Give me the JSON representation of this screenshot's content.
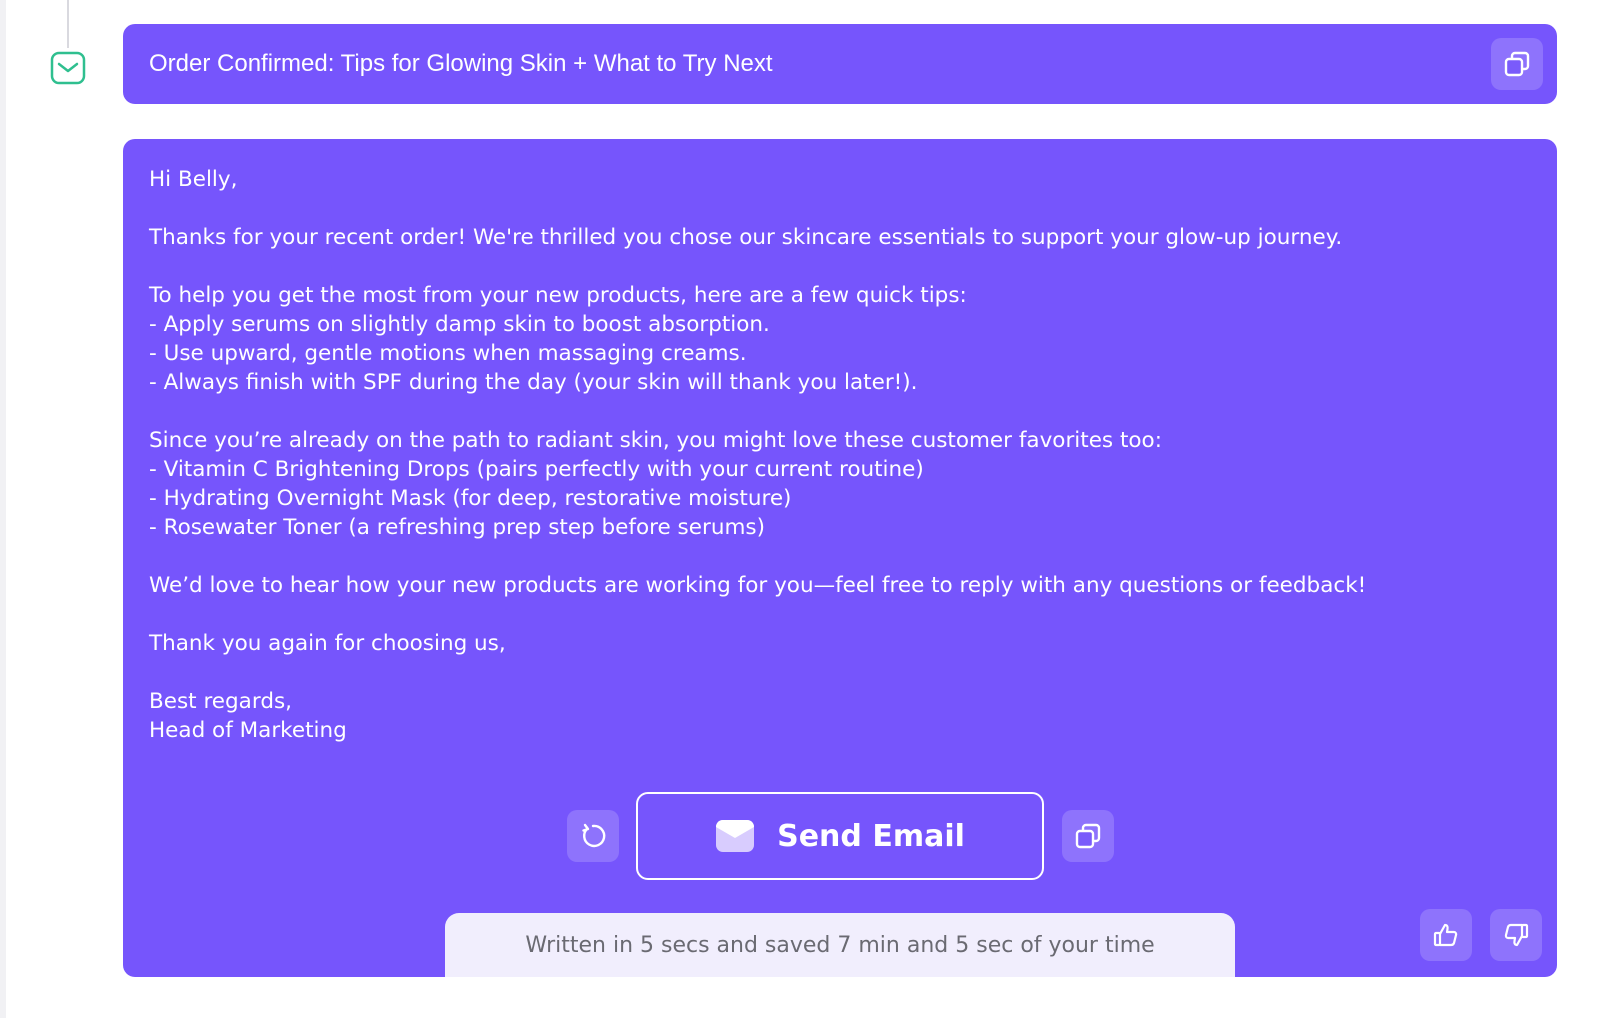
{
  "subject": {
    "text": "Order Confirmed: Tips for Glowing Skin + What to Try Next",
    "copy_icon": "copy-icon"
  },
  "timeline": {
    "icon": "mail-icon"
  },
  "email": {
    "lines": [
      "Hi Belly,",
      "",
      "Thanks for your recent order! We're thrilled you chose our skincare essentials to support your glow-up journey.",
      "",
      "To help you get the most from your new products, here are a few quick tips:",
      "- Apply serums on slightly damp skin to boost absorption.",
      "- Use upward, gentle motions when massaging creams.",
      "- Always finish with SPF during the day (your skin will thank you later!).",
      "",
      "Since you’re already on the path to radiant skin, you might love these customer favorites too:",
      "- Vitamin C Brightening Drops (pairs perfectly with your current routine)",
      "- Hydrating Overnight Mask (for deep, restorative moisture)",
      "- Rosewater Toner (a refreshing prep step before serums)",
      "",
      "We’d love to hear how your new products are working for you—feel free to reply with any questions or feedback!",
      "",
      "Thank you again for choosing us,",
      "",
      "Best regards,",
      "Head of Marketing"
    ]
  },
  "actions": {
    "send_label": "Send Email",
    "regenerate_icon": "refresh-icon",
    "copy_icon": "copy-icon",
    "send_icon": "envelope-icon"
  },
  "footer": {
    "note": "Written in 5 secs and saved 7 min and 5 sec of your time"
  },
  "feedback": {
    "up_icon": "thumbs-up-icon",
    "down_icon": "thumbs-down-icon"
  },
  "colors": {
    "accent": "#7655fc",
    "icon_green": "#2fbf8f",
    "note_bg": "#f1eefd",
    "note_text": "#6a6a72"
  }
}
